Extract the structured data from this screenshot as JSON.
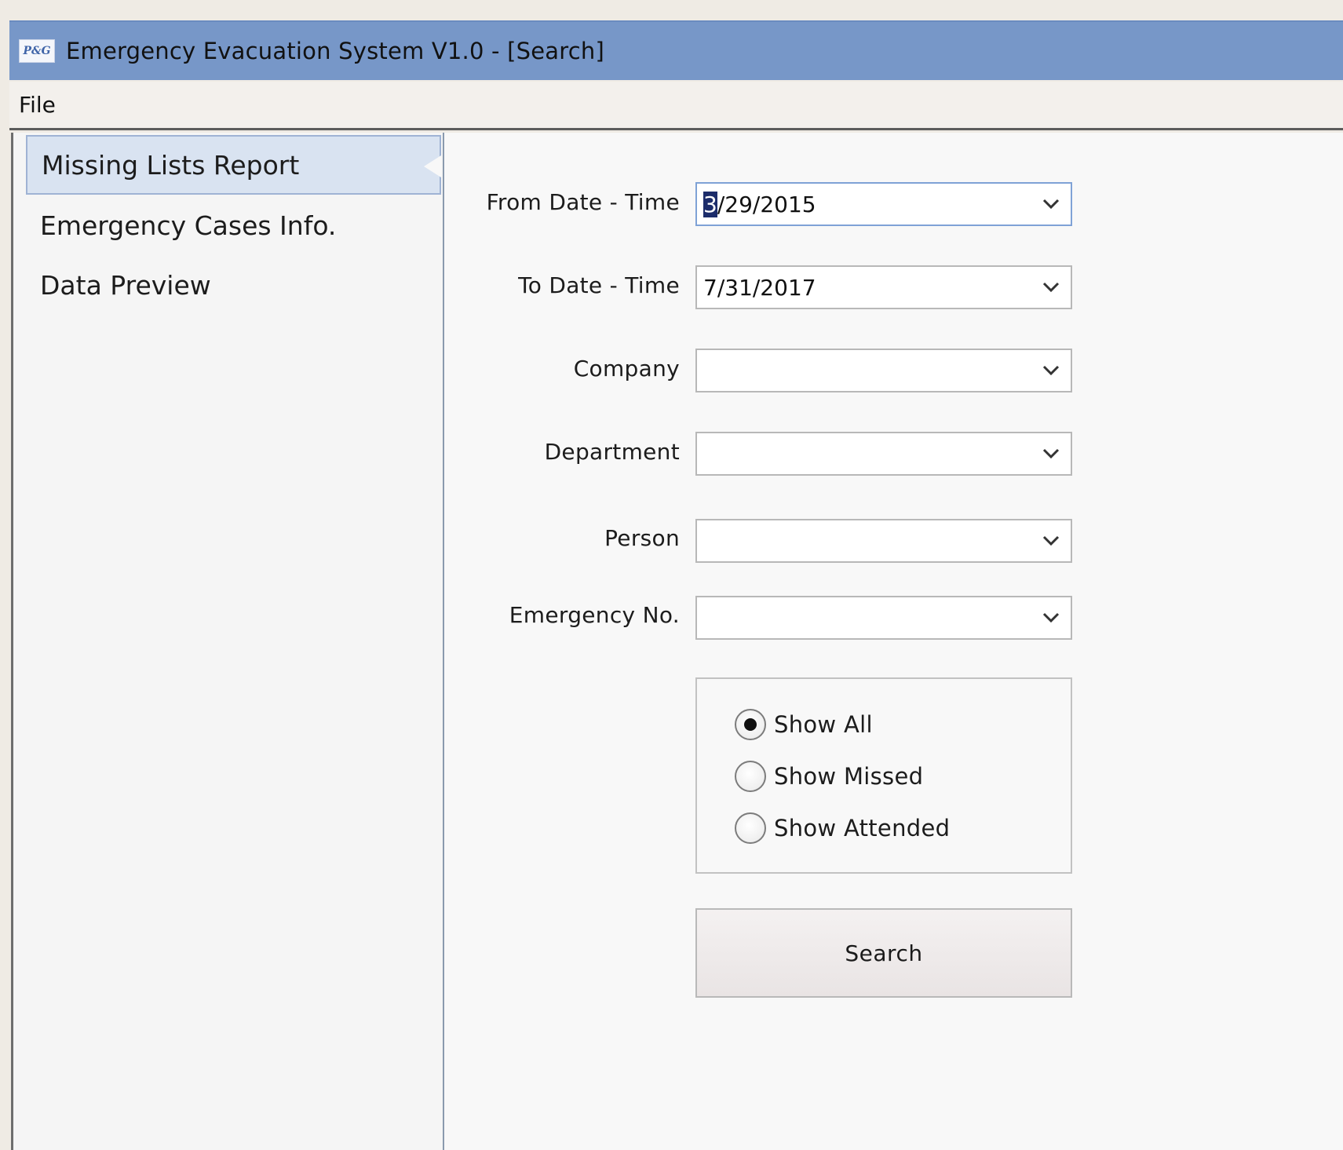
{
  "window": {
    "logo_text": "P&G",
    "title": "Emergency Evacuation System V1.0 - [Search]"
  },
  "menu": {
    "items": [
      {
        "label": "File"
      }
    ]
  },
  "nav": {
    "items": [
      {
        "label": "Missing Lists Report",
        "active": true
      },
      {
        "label": "Emergency Cases Info."
      },
      {
        "label": "Data Preview"
      }
    ]
  },
  "form": {
    "from_date": {
      "label": "From Date - Time",
      "value_first": "3",
      "value_rest": "/29/2015"
    },
    "to_date": {
      "label": "To Date - Time",
      "value": "7/31/2017"
    },
    "company": {
      "label": "Company",
      "value": ""
    },
    "department": {
      "label": "Department",
      "value": ""
    },
    "person": {
      "label": "Person",
      "value": ""
    },
    "emergency_no": {
      "label": "Emergency No.",
      "value": ""
    },
    "filter": {
      "options": [
        {
          "label": "Show All",
          "checked": true
        },
        {
          "label": "Show Missed",
          "checked": false
        },
        {
          "label": "Show Attended",
          "checked": false
        }
      ]
    },
    "search_label": "Search"
  }
}
